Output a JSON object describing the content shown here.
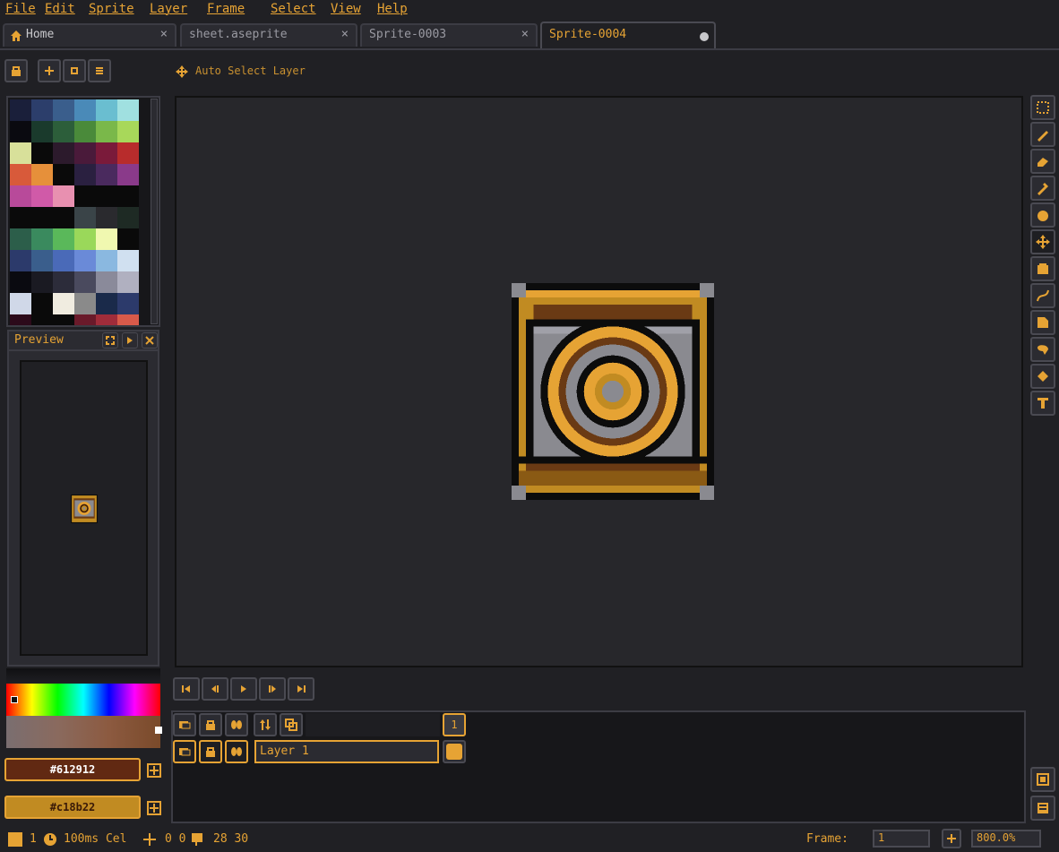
{
  "menu": [
    "File",
    "Edit",
    "Sprite",
    "Layer",
    "Frame",
    "Select",
    "View",
    "Help"
  ],
  "tabs": [
    {
      "label": "Home",
      "close": "×"
    },
    {
      "label": "sheet.aseprite",
      "close": "×"
    },
    {
      "label": "Sprite-0003",
      "close": "×"
    },
    {
      "label": "Sprite-0004"
    }
  ],
  "toolbar": {
    "auto_select_label": "Auto Select Layer"
  },
  "palette": {
    "colors": [
      [
        "#1a1f3a",
        "#2c3e6b",
        "#3a5e8c",
        "#4a8ab8",
        "#6abed0",
        "#a0e0e0"
      ],
      [
        "#0a0a10",
        "#1a3a2c",
        "#2c5e3a",
        "#4a8a3a",
        "#7ab84a",
        "#a8d85a"
      ],
      [
        "#d8e09a",
        "#0a0a0a",
        "#2c1a2c",
        "#4a1a3a",
        "#7a1a3a",
        "#b82c2c"
      ],
      [
        "#d85a3a",
        "#e6903a",
        "#0a0a0a",
        "#2a2040",
        "#4a2a5e",
        "#8a3a8a"
      ],
      [
        "#b84a9a",
        "#d05aa8",
        "#e890b0",
        "#0a0a0a",
        "#0a0a0a",
        "#0a0a0a"
      ],
      [
        "#0a0a0a",
        "#0a0a0a",
        "#0a0a0a",
        "#3a4448",
        "#2a2a2e",
        "#1e2a24"
      ],
      [
        "#2c5e4a",
        "#3a8a5e",
        "#5ab85a",
        "#9ad85a",
        "#f0f8b0",
        "#0a0a0a"
      ],
      [
        "#2c3a6b",
        "#3a5e8c",
        "#4a6ab8",
        "#6a8ad8",
        "#8ab8e0",
        "#d0e0f0"
      ],
      [
        "#0a0a10",
        "#1a1a22",
        "#2c2c3a",
        "#4a4a5e",
        "#8a8a9a",
        "#b0b0c0"
      ],
      [
        "#d0d8e8",
        "#0a0a0a",
        "#f0ece0",
        "#8a8a8a",
        "#1a2a4a",
        "#2c3a6b"
      ],
      [
        "#2c0a1a",
        "#0a0a0a",
        "#0a0a0a",
        "#6a1a2a",
        "#a02c3a",
        "#d85a4a"
      ]
    ]
  },
  "preview": {
    "title": "Preview"
  },
  "colors": {
    "fg_hex": "#612912",
    "bg_hex": "#c18b22",
    "fg_color": "#612912",
    "bg_color": "#c18b22"
  },
  "timeline": {
    "frame_header": "1",
    "layer_name": "Layer 1"
  },
  "status": {
    "frame_num": "1",
    "duration": "100ms Cel",
    "position": "0 0",
    "size": "28 30",
    "frame_label": "Frame:",
    "frame_value": "1",
    "zoom": "800.0%"
  }
}
